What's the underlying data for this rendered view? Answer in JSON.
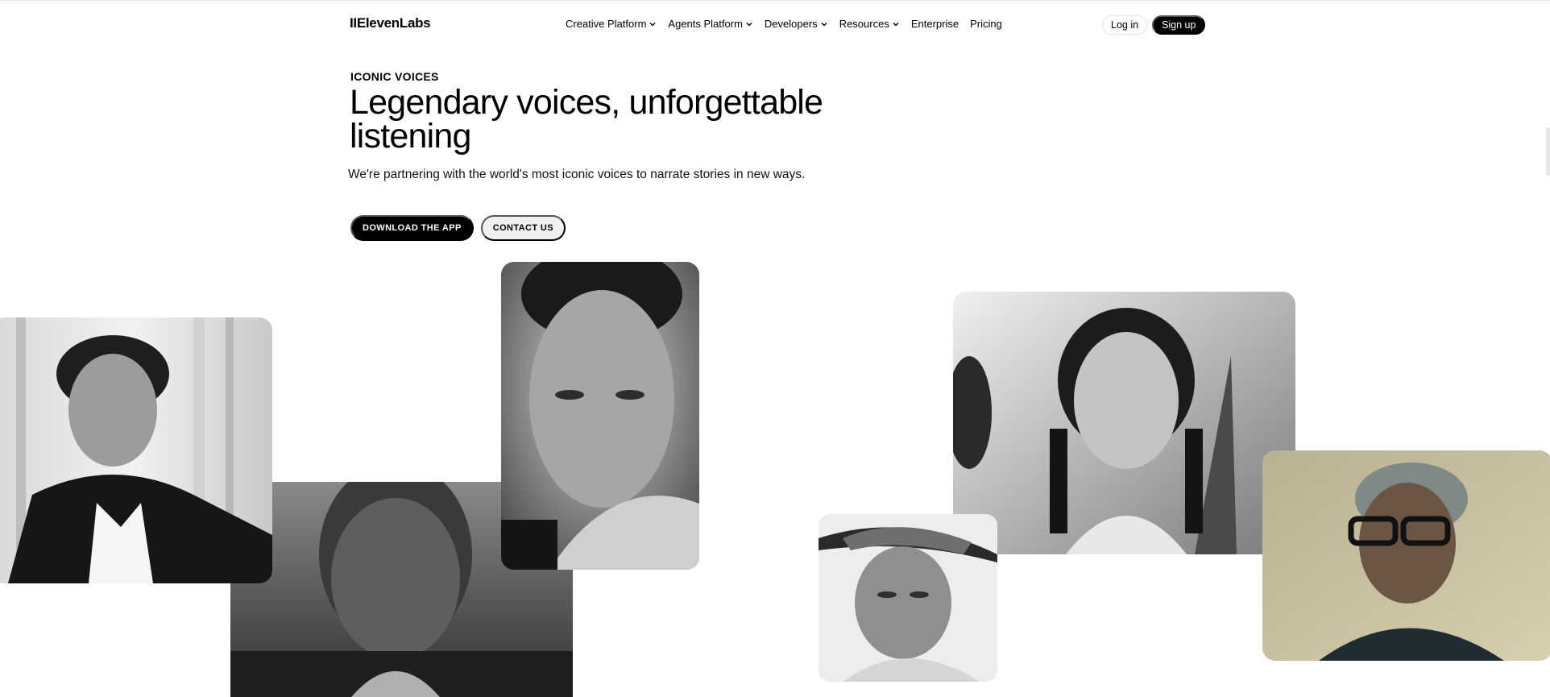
{
  "header": {
    "logo": "IIElevenLabs",
    "nav": [
      {
        "label": "Creative Platform",
        "dropdown": true
      },
      {
        "label": "Agents Platform",
        "dropdown": true
      },
      {
        "label": "Developers",
        "dropdown": true
      },
      {
        "label": "Resources",
        "dropdown": true
      },
      {
        "label": "Enterprise",
        "dropdown": false
      },
      {
        "label": "Pricing",
        "dropdown": false
      }
    ],
    "login_label": "Log in",
    "signup_label": "Sign up"
  },
  "hero": {
    "eyebrow": "ICONIC VOICES",
    "headline": "Legendary voices, unforgettable listening",
    "subtitle": "We're partnering with the world's most iconic voices to narrate stories in new ways.",
    "primary_cta": "DOWNLOAD THE APP",
    "secondary_cta": "CONTACT US"
  },
  "colors": {
    "brand_black": "#000000",
    "background": "#ffffff",
    "secondary_button": "#f0f0f0"
  }
}
